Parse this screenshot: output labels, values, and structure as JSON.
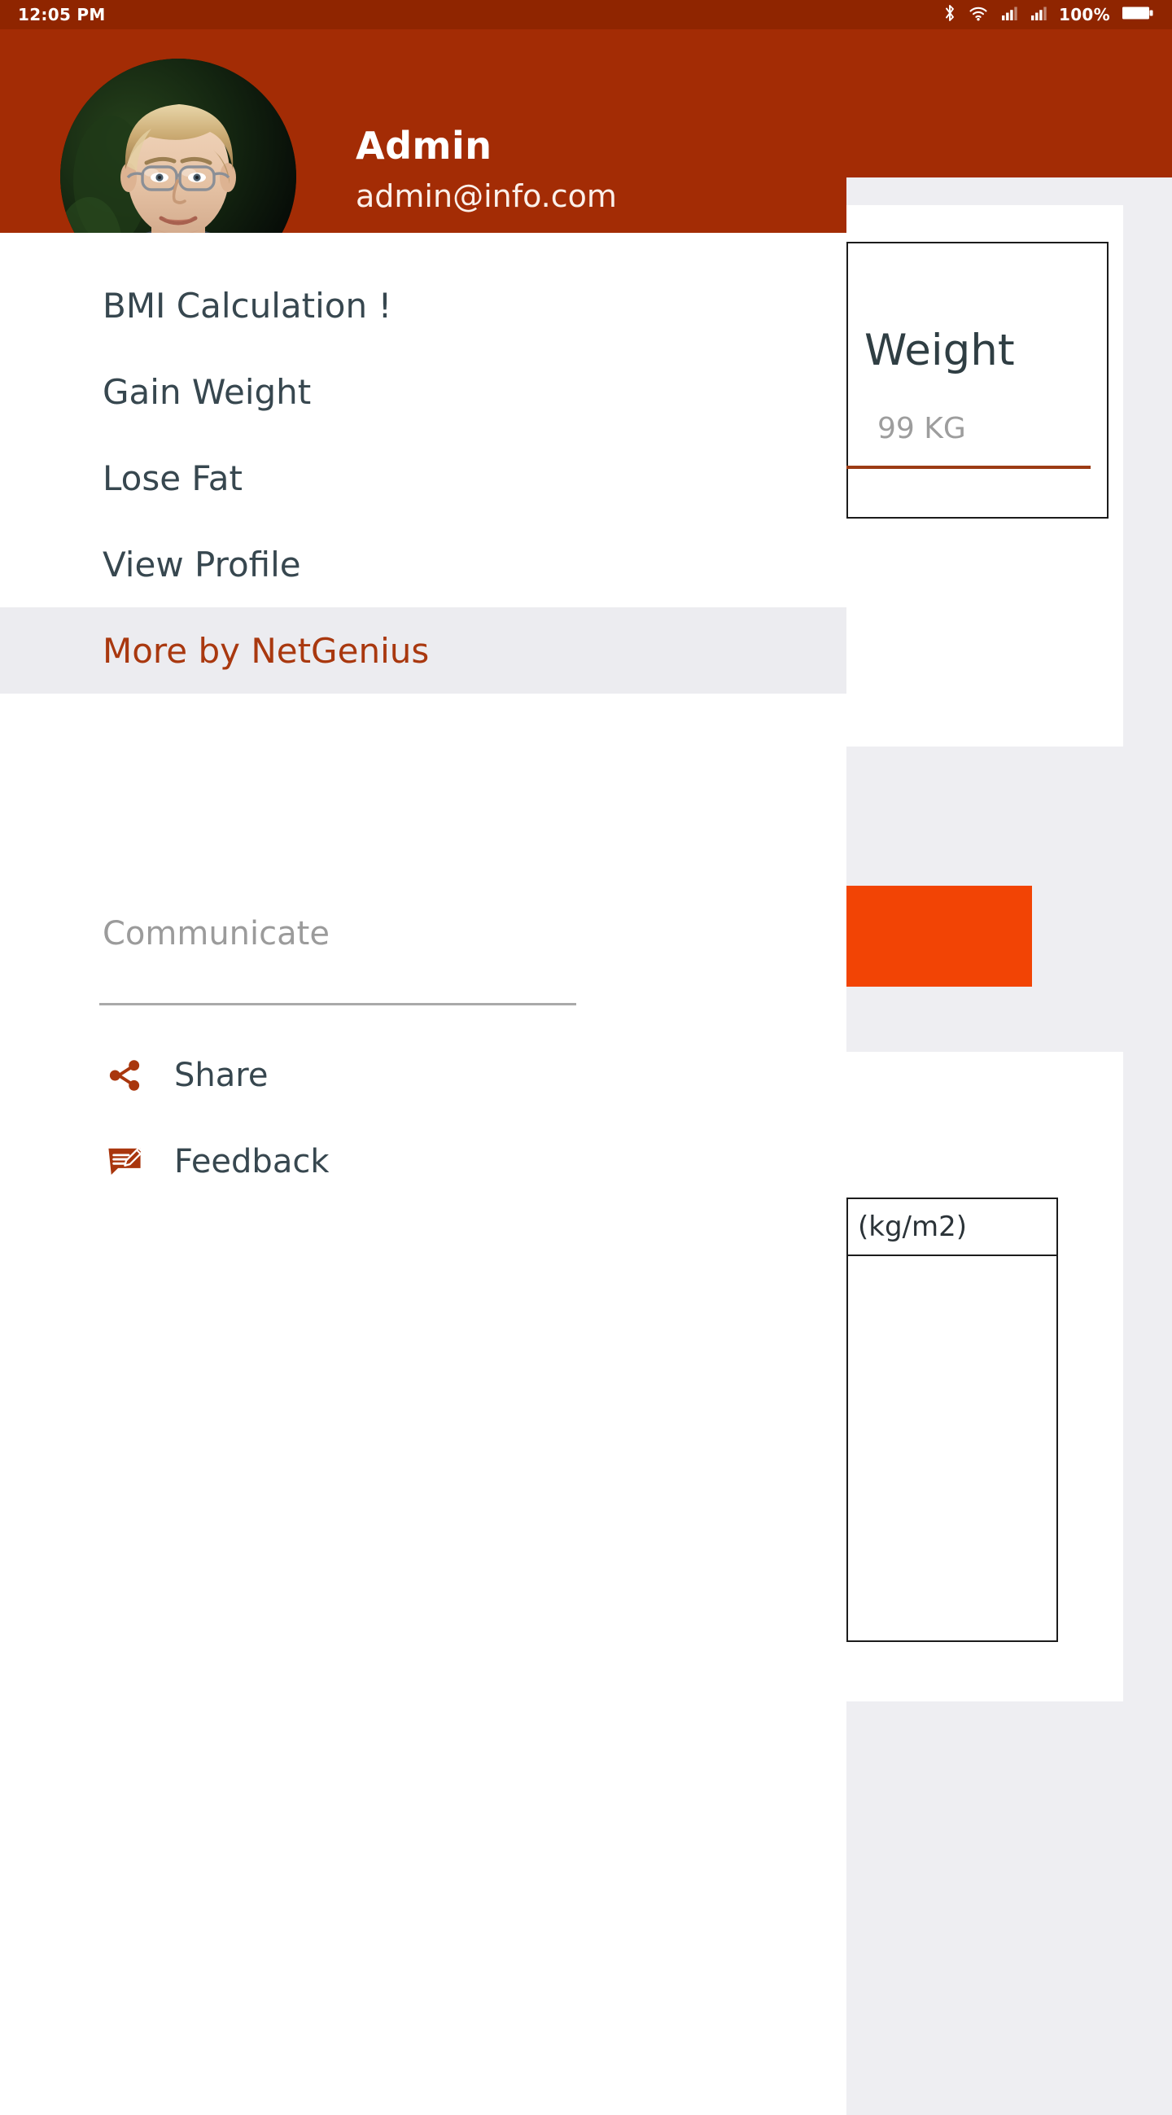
{
  "status_bar": {
    "time": "12:05 PM",
    "battery_percent": "100%",
    "icons": [
      "bluetooth-icon",
      "wifi-icon",
      "signal-sim1-icon",
      "signal-sim2-icon",
      "battery-icon"
    ]
  },
  "theme": {
    "primary": "#a32c05",
    "primary_dark": "#8f2500",
    "accent": "#f24405",
    "selected_bg": "#ececf0",
    "selected_text": "#a9380f",
    "text": "#37474f",
    "muted": "#9b9b9b",
    "page_bg": "#eeeef2",
    "card_bg": "#ffffff"
  },
  "drawer": {
    "user": {
      "name": "Admin",
      "email": "admin@info.com",
      "avatar": "user-avatar-photo"
    },
    "items": [
      {
        "label": "BMI Calculation !",
        "name": "bmi-calculation",
        "selected": false
      },
      {
        "label": "Gain Weight",
        "name": "gain-weight",
        "selected": false
      },
      {
        "label": "Lose Fat",
        "name": "lose-fat",
        "selected": false
      },
      {
        "label": "View Profile",
        "name": "view-profile",
        "selected": false
      },
      {
        "label": "More by NetGenius",
        "name": "more-by-netgenius",
        "selected": true
      }
    ],
    "section": {
      "title": "Communicate",
      "items": [
        {
          "label": "Share",
          "icon": "share-icon"
        },
        {
          "label": "Feedback",
          "icon": "feedback-icon"
        }
      ]
    }
  },
  "main": {
    "weight_card": {
      "title": "Weight",
      "value_placeholder": "99 KG"
    },
    "calculate_button": {
      "label": ""
    },
    "bmi_table": {
      "unit_header": "(kg/m2)",
      "rows": []
    }
  }
}
